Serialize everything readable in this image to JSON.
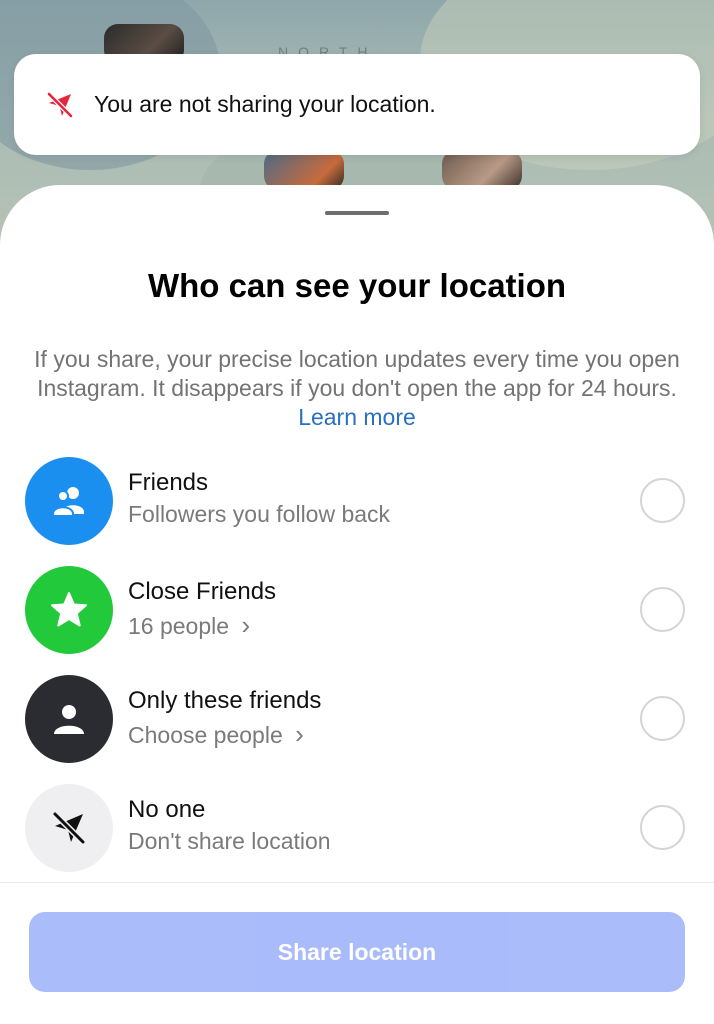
{
  "map": {
    "label": "NORTH"
  },
  "banner": {
    "icon": "location-off-icon",
    "text": "You are not sharing your location."
  },
  "sheet": {
    "title": "Who can see your location",
    "description": "If you share, your precise location updates every time you open Instagram. It disappears if you don't open the app for 24 hours.",
    "learn_more": "Learn more",
    "options": [
      {
        "title": "Friends",
        "subtitle": "Followers you follow back",
        "icon": "friends-icon",
        "color": "#1a8ff0",
        "selected": false
      },
      {
        "title": "Close Friends",
        "subtitle": "16 people",
        "icon": "star-icon",
        "color": "#21c93b",
        "selected": false
      },
      {
        "title": "Only these friends",
        "subtitle": "Choose people",
        "icon": "person-icon",
        "color": "#2b2c31",
        "selected": false
      },
      {
        "title": "No one",
        "subtitle": "Don't share location",
        "icon": "location-off-icon",
        "color": "#efeff1",
        "selected": false
      }
    ],
    "chevron": "›",
    "share_button": "Share location"
  },
  "colors": {
    "accent_link": "#2a6fc2",
    "button_disabled": "#a6b8fb"
  }
}
